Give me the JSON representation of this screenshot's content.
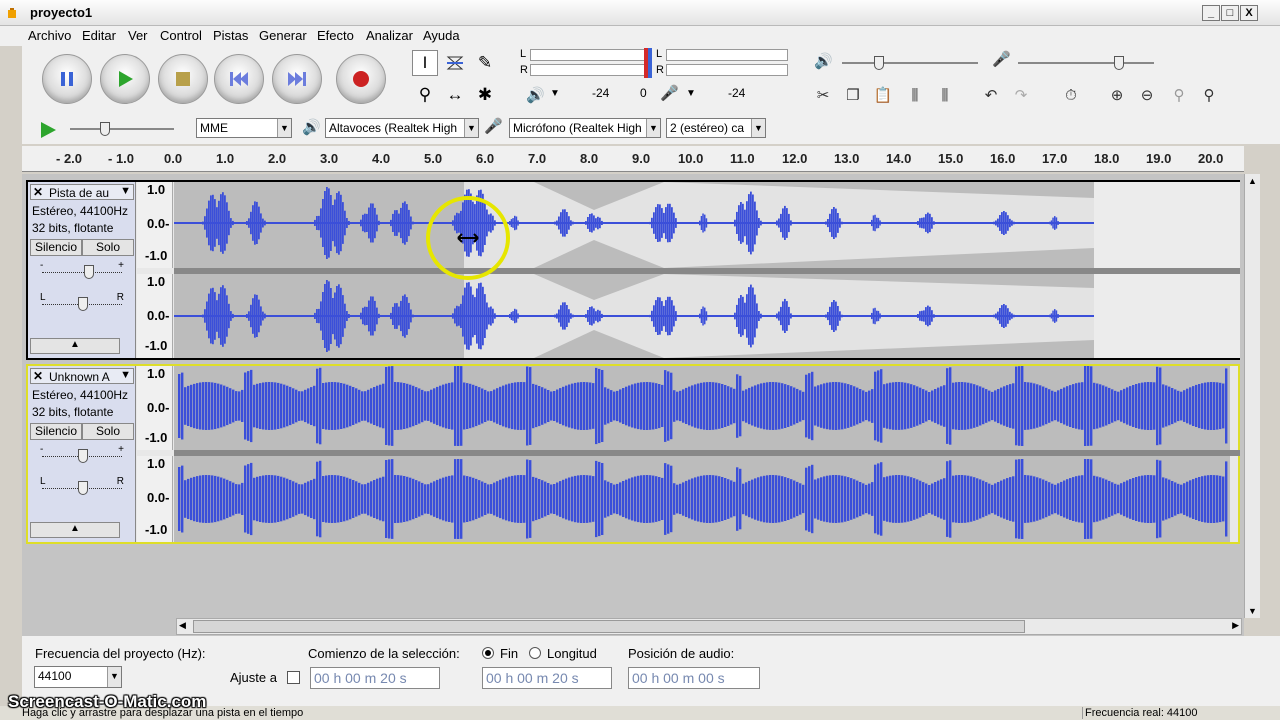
{
  "window": {
    "title": "proyecto1",
    "controls": [
      "_",
      "□",
      "X"
    ]
  },
  "menu": [
    "Archivo",
    "Editar",
    "Ver",
    "Control",
    "Pistas",
    "Generar",
    "Efecto",
    "Analizar",
    "Ayuda"
  ],
  "transport": {
    "buttons": [
      "pause-icon",
      "play-icon",
      "stop-icon",
      "skip-start-icon",
      "skip-end-icon",
      "record-icon"
    ],
    "colors": {
      "pause": "#3a63d6",
      "play": "#2da52d",
      "stop": "#b8a04a",
      "skip": "#6c7ddd",
      "record": "#cc2222"
    }
  },
  "tools": [
    "selection-tool-icon",
    "envelope-tool-icon",
    "draw-tool-icon",
    "zoom-tool-icon",
    "timeshift-tool-icon",
    "multi-tool-icon"
  ],
  "meters": {
    "play": {
      "L": "L",
      "R": "R"
    },
    "record": {
      "L": "L",
      "R": "R"
    },
    "scale_left": "-24",
    "scale_mid": "0",
    "scale_right": "-24"
  },
  "devices": {
    "host": "MME",
    "output": "Altavoces (Realtek High",
    "input": "Micrófono (Realtek High",
    "channels": "2 (estéreo) ca"
  },
  "ruler": {
    "ticks": [
      "- 2.0",
      "- 1.0",
      "0.0",
      "1.0",
      "2.0",
      "3.0",
      "4.0",
      "5.0",
      "6.0",
      "7.0",
      "8.0",
      "9.0",
      "10.0",
      "11.0",
      "12.0",
      "13.0",
      "14.0",
      "15.0",
      "16.0",
      "17.0",
      "18.0",
      "19.0",
      "20.0"
    ]
  },
  "tracks": [
    {
      "name": "Pista de au",
      "info1": "Estéreo, 44100Hz",
      "info2": "32 bits, flotante",
      "mute": "Silencio",
      "solo": "Solo",
      "scale": [
        "1.0",
        "0.0-",
        "-1.0"
      ],
      "selected": false
    },
    {
      "name": "Unknown A",
      "info1": "Estéreo, 44100Hz",
      "info2": "32 bits, flotante",
      "mute": "Silencio",
      "solo": "Solo",
      "scale": [
        "1.0",
        "0.0-",
        "-1.0"
      ],
      "selected": true
    }
  ],
  "slider_labels": {
    "gain_minus": "-",
    "gain_plus": "+",
    "pan_l": "L",
    "pan_r": "R"
  },
  "bottom": {
    "rate_label": "Frecuencia del proyecto (Hz):",
    "rate_value": "44100",
    "snap_label": "Ajuste a",
    "sel_start_label": "Comienzo de la selección:",
    "end_label": "Fin",
    "length_label": "Longitud",
    "audio_pos_label": "Posición de audio:",
    "sel_start": "00 h 00 m 20 s",
    "sel_end": "00 h 00 m 20 s",
    "audio_pos": "00 h 00 m 00 s"
  },
  "status": {
    "left": "Haga clic y arrastre para desplazar una pista en el tiempo",
    "right": "Frecuencia real: 44100"
  },
  "watermark": "Screencast-O-Matic.com"
}
